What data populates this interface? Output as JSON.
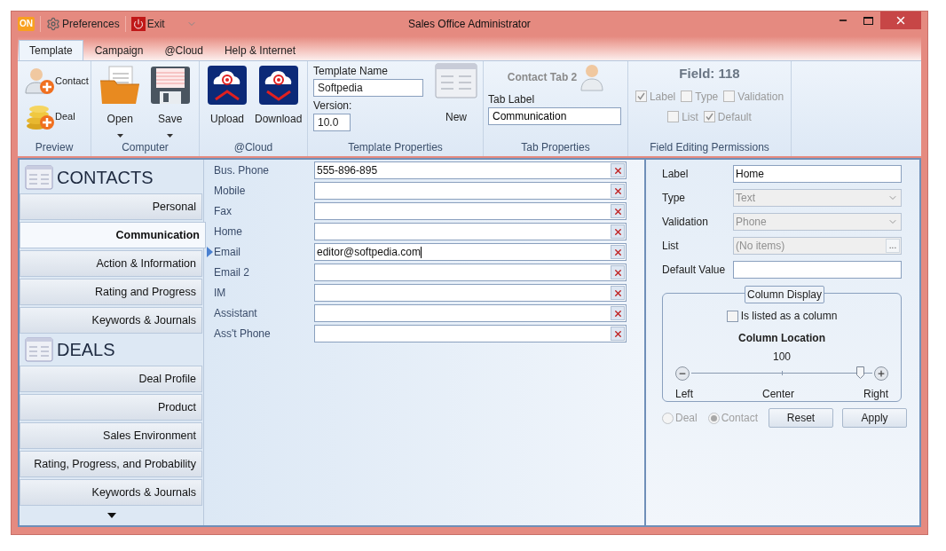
{
  "window": {
    "title": "Sales Office Administrator"
  },
  "quick_access": [
    {
      "kind": "logo",
      "label": "ON"
    },
    {
      "kind": "gear",
      "label": "Preferences"
    },
    {
      "kind": "power",
      "label": "Exit"
    }
  ],
  "ribbon_tabs": [
    {
      "label": "Template",
      "selected": true
    },
    {
      "label": "Campaign",
      "selected": false
    },
    {
      "label": "@Cloud",
      "selected": false
    },
    {
      "label": "Help & Internet",
      "selected": false
    }
  ],
  "ribbon_groups": [
    {
      "kind": "small_buttons",
      "label": "Preview",
      "buttons": [
        {
          "label": "Contact"
        },
        {
          "label": "Deal"
        }
      ]
    },
    {
      "kind": "large_buttons",
      "label": "Computer",
      "buttons": [
        {
          "label": "Open",
          "dropdown": true
        },
        {
          "label": "Save",
          "dropdown": true
        }
      ]
    },
    {
      "kind": "large_buttons",
      "label": "@Cloud",
      "buttons": [
        {
          "label": "Upload",
          "dropdown": false
        },
        {
          "label": "Download",
          "dropdown": false
        }
      ]
    },
    {
      "kind": "template",
      "label": "Template Properties",
      "name_label": "Template Name",
      "name_value": "Softpedia",
      "version_label": "Version:",
      "version_value": "10.0",
      "new_label": "New"
    },
    {
      "kind": "tab",
      "label": "Tab Properties",
      "heading": "Contact Tab 2",
      "tab_label": "Tab Label",
      "tab_value": "Communication"
    },
    {
      "kind": "permissions",
      "label": "Field Editing Permissions",
      "heading": "Field: 118",
      "rows": [
        [
          {
            "label": "Label",
            "checked": true
          },
          {
            "label": "Type",
            "checked": false
          },
          {
            "label": "Validation",
            "checked": false
          }
        ],
        [
          {
            "label": "List",
            "checked": false
          },
          {
            "label": "Default",
            "checked": true
          }
        ]
      ]
    }
  ],
  "nav": [
    {
      "title": "CONTACTS",
      "items": [
        {
          "label": "Personal",
          "selected": false
        },
        {
          "label": "Communication",
          "selected": true
        },
        {
          "label": "Action & Information",
          "selected": false
        },
        {
          "label": "Rating and Progress",
          "selected": false
        },
        {
          "label": "Keywords & Journals",
          "selected": false
        }
      ]
    },
    {
      "title": "DEALS",
      "items": [
        {
          "label": "Deal Profile",
          "selected": false
        },
        {
          "label": "Product",
          "selected": false
        },
        {
          "label": "Sales Environment",
          "selected": false
        },
        {
          "label": "Rating, Progress, and Probability",
          "selected": false
        },
        {
          "label": "Keywords & Journals",
          "selected": false
        }
      ]
    }
  ],
  "fields": [
    {
      "label": "Bus. Phone",
      "value": "555-896-895",
      "selected": false
    },
    {
      "label": "Mobile",
      "selected": false
    },
    {
      "label": "Fax",
      "selected": false
    },
    {
      "label": "Home",
      "selected": false
    },
    {
      "label": "Email",
      "value": "editor@softpedia.com",
      "selected": true
    },
    {
      "label": "Email 2",
      "selected": false
    },
    {
      "label": "IM",
      "selected": false
    },
    {
      "label": "Assistant",
      "selected": false
    },
    {
      "label": "Ass't Phone",
      "selected": false
    }
  ],
  "properties": [
    {
      "kind": "text",
      "label": "Label",
      "value": "Home"
    },
    {
      "kind": "combo",
      "label": "Type",
      "value": "Text"
    },
    {
      "kind": "combo",
      "label": "Validation",
      "value": "Phone"
    },
    {
      "kind": "list",
      "label": "List",
      "value": "(No items)",
      "button": "..."
    },
    {
      "kind": "text",
      "label": "Default Value"
    }
  ],
  "column_display": {
    "title": "Column Display",
    "listed": {
      "label": "Is listed as a column",
      "checked": false
    },
    "location_title": "Column Location",
    "reading": "100",
    "level": 0.93,
    "left": "Left",
    "center": "Center",
    "right": "Right"
  },
  "record_types": [
    {
      "label": "Deal",
      "selected": false
    },
    {
      "label": "Contact",
      "selected": true
    }
  ],
  "buttons": [
    "Reset",
    "Apply"
  ]
}
